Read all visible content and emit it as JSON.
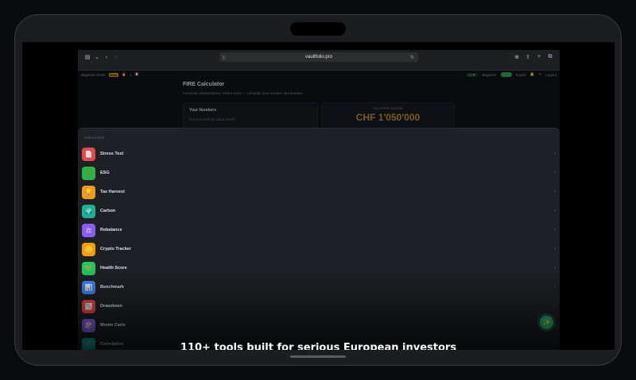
{
  "browser": {
    "url": "vaultfolio.pro",
    "icons": [
      "sidebar-icon",
      "chevron-down-icon",
      "back-icon",
      "forward-icon",
      "reader-icon",
      "translate-icon",
      "reload-icon",
      "download-icon",
      "share-icon",
      "new-tab-icon",
      "tabs-icon"
    ]
  },
  "app": {
    "nav": {
      "mode": "Beginner Mode",
      "tag": "Beta",
      "streak": "1",
      "currency": "CHF",
      "beginner": "Beginner",
      "expert": "Expert",
      "logout": "Logout"
    },
    "page": {
      "title": "FIRE Calculator",
      "subtitle": "Financial Independence, Retire Early — calculate your number and timeline.",
      "numbers_title": "Your Numbers",
      "portfolio_label": "Current portfolio value (CHF)",
      "fire_number_label": "Your FIRE Number",
      "fire_number": "CHF 1'050'000"
    }
  },
  "menu": {
    "section": "ANALYSIS",
    "items": [
      {
        "label": "Stress Test",
        "icon": "document-icon",
        "color": "#e5484d",
        "glyph": "📄"
      },
      {
        "label": "ESG",
        "icon": "leaf-icon",
        "color": "#2bb24c",
        "glyph": "🌿"
      },
      {
        "label": "Tax Harvest",
        "icon": "lightbulb-icon",
        "color": "#f29a1f",
        "glyph": "💡"
      },
      {
        "label": "Carbon",
        "icon": "globe-icon",
        "color": "#1fb090",
        "glyph": "🌍"
      },
      {
        "label": "Rebalance",
        "icon": "scale-icon",
        "color": "#8b5cf6",
        "glyph": "⚖"
      },
      {
        "label": "Crypto Tracker",
        "icon": "coin-icon",
        "color": "#f59e0b",
        "glyph": "🪙"
      },
      {
        "label": "Health Score",
        "icon": "heart-icon",
        "color": "#22c55e",
        "glyph": "💚"
      },
      {
        "label": "Benchmark",
        "icon": "chart-icon",
        "color": "#3b82f6",
        "glyph": "📊"
      },
      {
        "label": "Drawdown",
        "icon": "chart-down-icon",
        "color": "#ef4444",
        "glyph": "📉"
      },
      {
        "label": "Monte Carlo",
        "icon": "dice-icon",
        "color": "#8b5cf6",
        "glyph": "🎲"
      },
      {
        "label": "Correlation",
        "icon": "link-icon",
        "color": "#14b8a6",
        "glyph": "🔗"
      }
    ]
  },
  "fab": {
    "icon": "sparkle-icon"
  },
  "caption": "110+ tools built for serious European investors"
}
